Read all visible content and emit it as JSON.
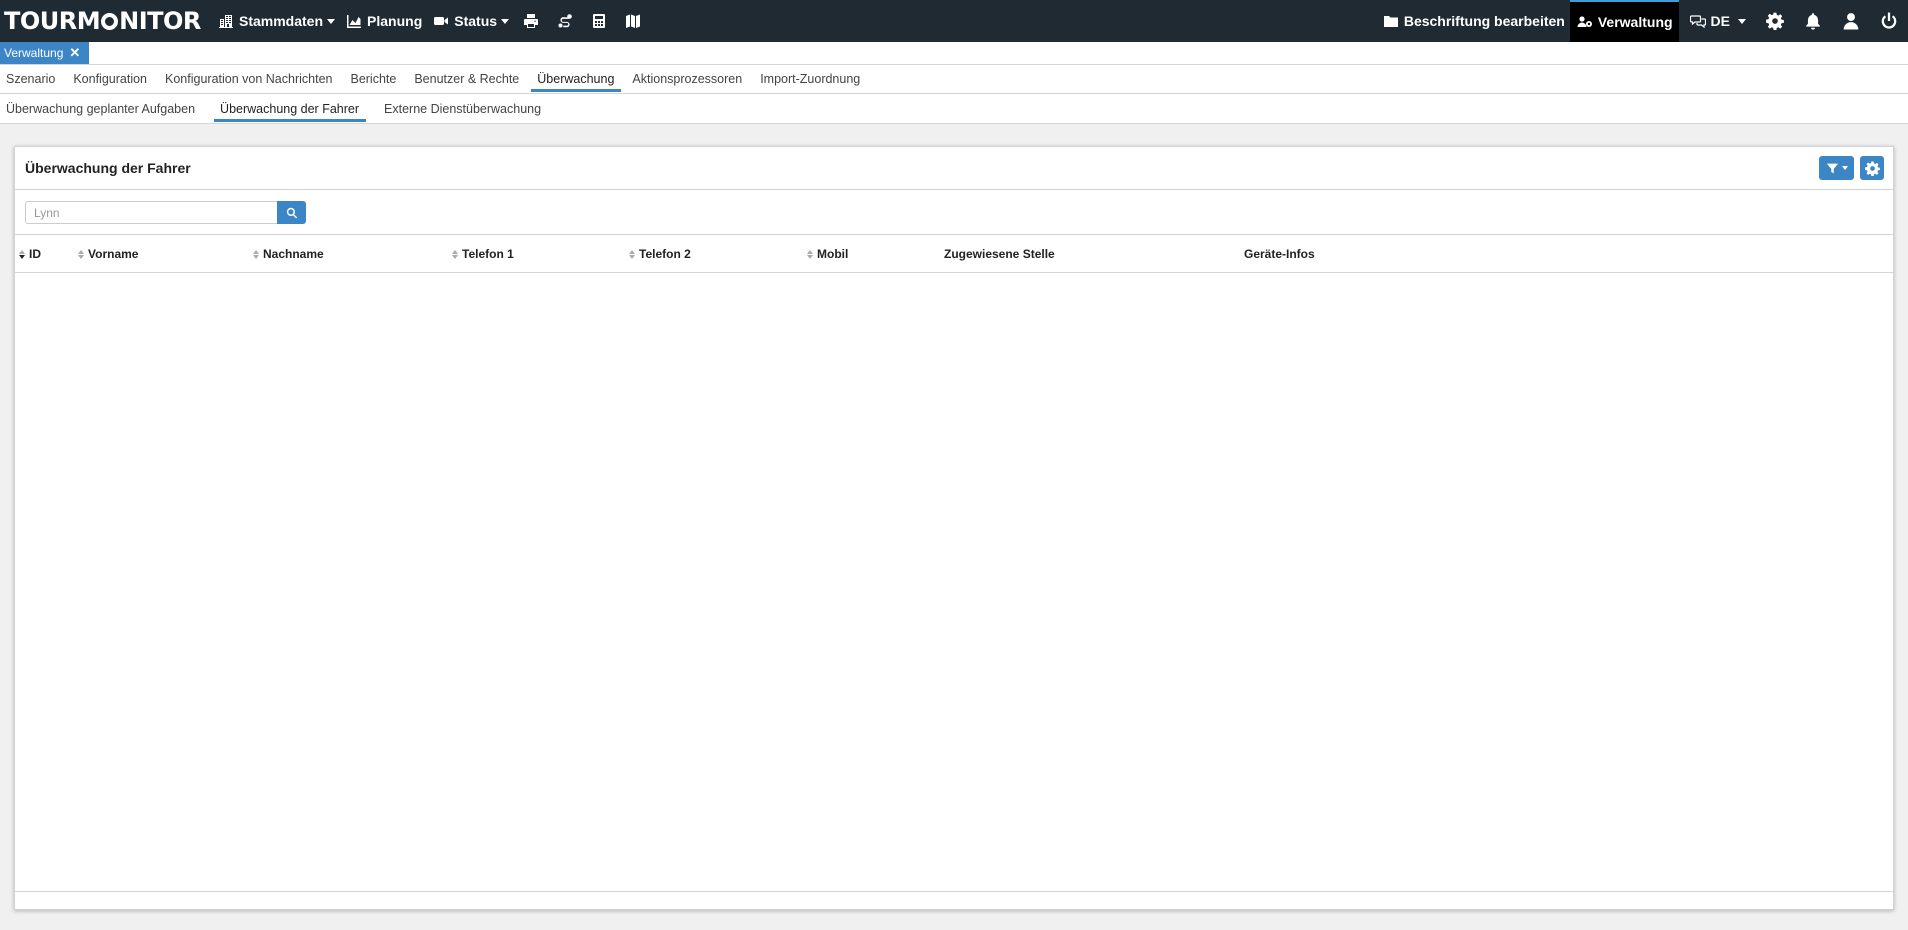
{
  "brand": {
    "logo_pre": "TOURM",
    "logo_post": "NITOR"
  },
  "topnav": {
    "stammdaten": "Stammdaten",
    "planung": "Planung",
    "status": "Status",
    "icons": [
      "print-icon",
      "route-icon",
      "calculator-icon",
      "map-icon"
    ]
  },
  "rightnav": {
    "beschriftung": "Beschriftung bearbeiten",
    "verwaltung": "Verwaltung",
    "language": "DE"
  },
  "open_tab": {
    "label": "Verwaltung",
    "close": "✕"
  },
  "menu": {
    "items": [
      "Szenario",
      "Konfiguration",
      "Konfiguration von Nachrichten",
      "Berichte",
      "Benutzer & Rechte",
      "Überwachung",
      "Aktionsprozessoren",
      "Import-Zuordnung"
    ],
    "active": "Überwachung"
  },
  "submenu": {
    "items": [
      "Überwachung geplanter Aufgaben",
      "Überwachung der Fahrer",
      "Externe Dienstüberwachung"
    ],
    "active": "Überwachung der Fahrer"
  },
  "panel": {
    "title": "Überwachung der Fahrer",
    "search_placeholder": "Lynn"
  },
  "table": {
    "columns": [
      "ID",
      "Vorname",
      "Nachname",
      "Telefon 1",
      "Telefon 2",
      "Mobil",
      "Zugewiesene Stelle",
      "Geräte-Infos"
    ],
    "rows": []
  },
  "colors": {
    "topbar": "#1f2a33",
    "accent": "#3d86c6"
  }
}
